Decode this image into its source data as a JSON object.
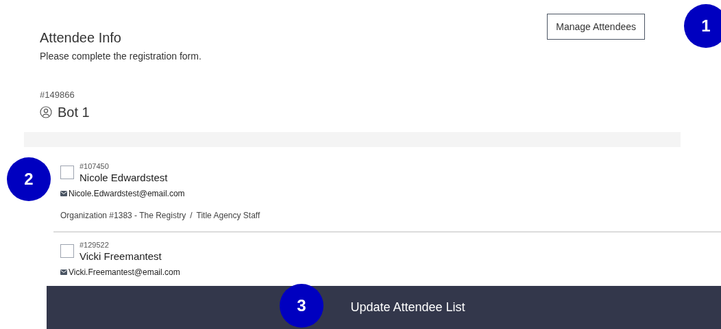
{
  "header": {
    "title": "Attendee Info",
    "subtitle": "Please complete the registration form.",
    "manage_button": "Manage Attendees"
  },
  "registrant": {
    "number": "#149866",
    "name": "Bot 1"
  },
  "attendees": [
    {
      "number": "#107450",
      "name": "Nicole Edwardstest",
      "email": "Nicole.Edwardstest@email.com",
      "checked": false,
      "organization": "Organization #1383 - The Registry",
      "separator": "/",
      "title": "Title Agency Staff"
    },
    {
      "number": "#129522",
      "name": "Vicki Freemantest",
      "email": "Vicki.Freemantest@email.com",
      "checked": false
    }
  ],
  "footer": {
    "button": "Update Attendee List"
  },
  "callouts": [
    "1",
    "2",
    "3"
  ]
}
